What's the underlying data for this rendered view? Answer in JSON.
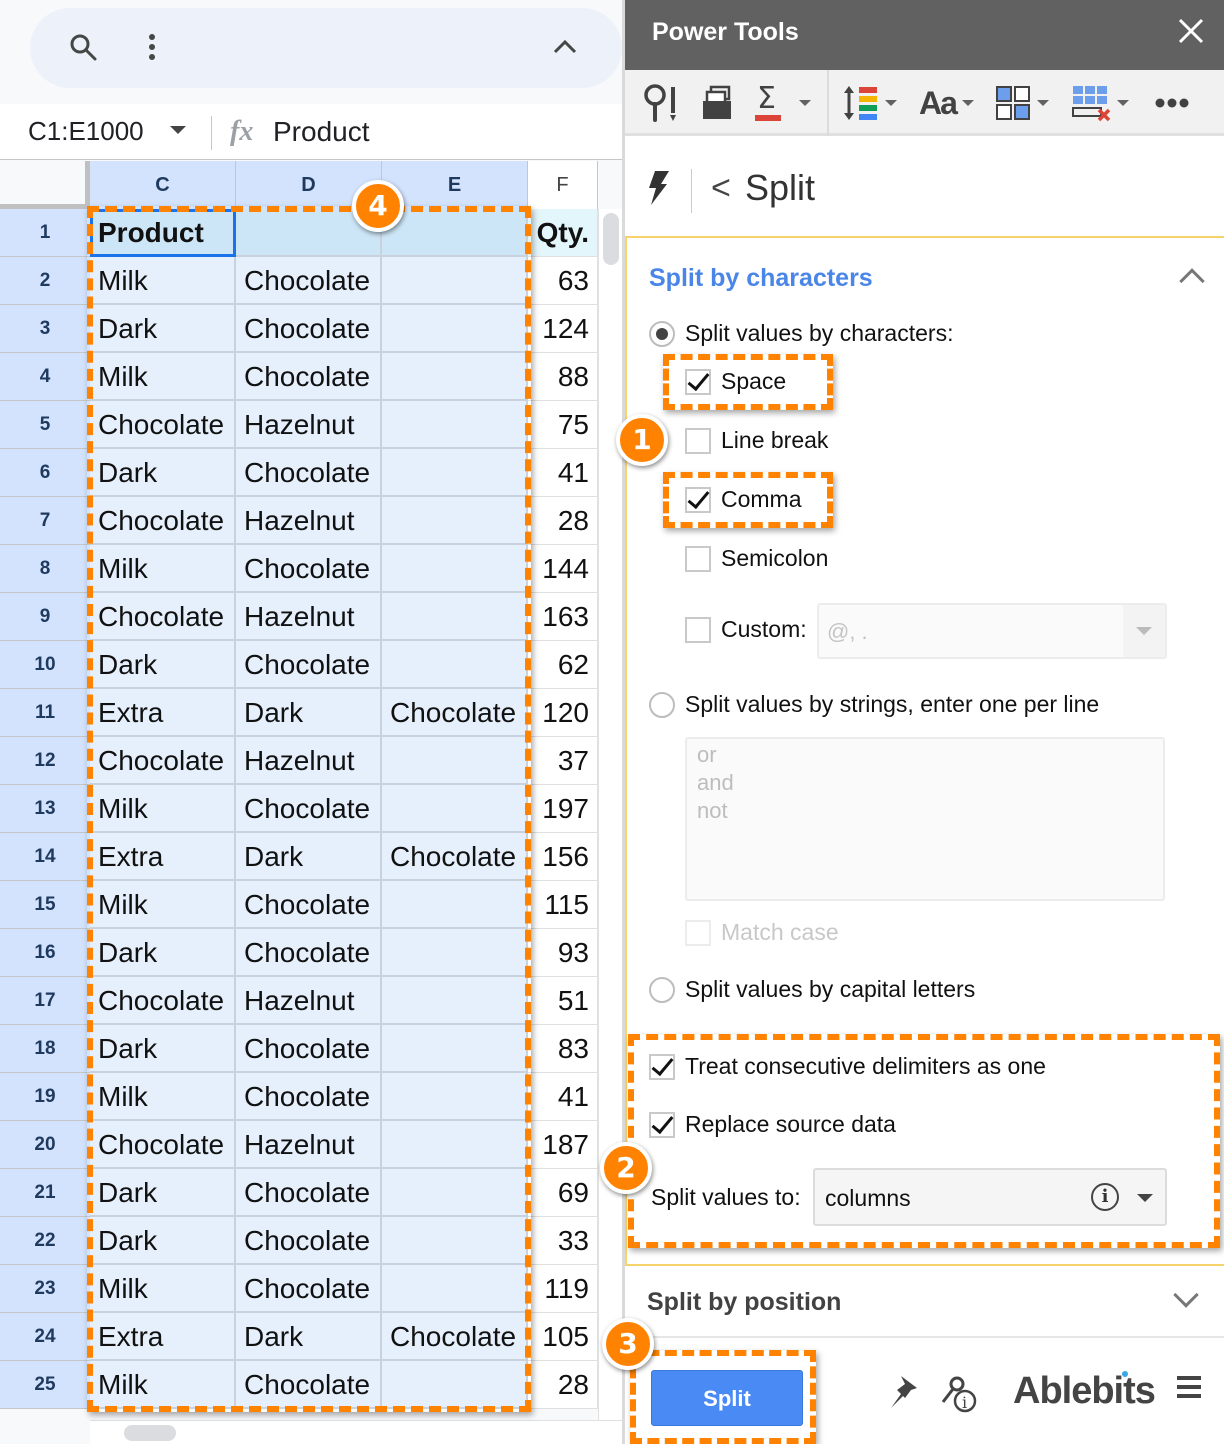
{
  "sheet": {
    "topbar": {
      "search_icon": "search-icon",
      "more_icon": "more-vert-icon",
      "collapse_icon": "chevron-up-icon"
    },
    "name_box": "C1:E1000",
    "formula_value": "Product",
    "fx_label": "fx",
    "columns": [
      "C",
      "D",
      "E",
      "F"
    ],
    "header": {
      "row": "1",
      "C": "Product",
      "D": "",
      "E": "",
      "F": "Qty."
    },
    "rows": [
      {
        "n": "2",
        "C": "Milk",
        "D": "Chocolate",
        "E": "",
        "F": "63"
      },
      {
        "n": "3",
        "C": "Dark",
        "D": "Chocolate",
        "E": "",
        "F": "124"
      },
      {
        "n": "4",
        "C": "Milk",
        "D": "Chocolate",
        "E": "",
        "F": "88"
      },
      {
        "n": "5",
        "C": "Chocolate",
        "D": "Hazelnut",
        "E": "",
        "F": "75"
      },
      {
        "n": "6",
        "C": "Dark",
        "D": "Chocolate",
        "E": "",
        "F": "41"
      },
      {
        "n": "7",
        "C": "Chocolate",
        "D": "Hazelnut",
        "E": "",
        "F": "28"
      },
      {
        "n": "8",
        "C": "Milk",
        "D": "Chocolate",
        "E": "",
        "F": "144"
      },
      {
        "n": "9",
        "C": "Chocolate",
        "D": "Hazelnut",
        "E": "",
        "F": "163"
      },
      {
        "n": "10",
        "C": "Dark",
        "D": "Chocolate",
        "E": "",
        "F": "62"
      },
      {
        "n": "11",
        "C": "Extra",
        "D": "Dark",
        "E": "Chocolate",
        "F": "120"
      },
      {
        "n": "12",
        "C": "Chocolate",
        "D": "Hazelnut",
        "E": "",
        "F": "37"
      },
      {
        "n": "13",
        "C": "Milk",
        "D": "Chocolate",
        "E": "",
        "F": "197"
      },
      {
        "n": "14",
        "C": "Extra",
        "D": "Dark",
        "E": "Chocolate",
        "F": "156"
      },
      {
        "n": "15",
        "C": "Milk",
        "D": "Chocolate",
        "E": "",
        "F": "115"
      },
      {
        "n": "16",
        "C": "Dark",
        "D": "Chocolate",
        "E": "",
        "F": "93"
      },
      {
        "n": "17",
        "C": "Chocolate",
        "D": "Hazelnut",
        "E": "",
        "F": "51"
      },
      {
        "n": "18",
        "C": "Dark",
        "D": "Chocolate",
        "E": "",
        "F": "83"
      },
      {
        "n": "19",
        "C": "Milk",
        "D": "Chocolate",
        "E": "",
        "F": "41"
      },
      {
        "n": "20",
        "C": "Chocolate",
        "D": "Hazelnut",
        "E": "",
        "F": "187"
      },
      {
        "n": "21",
        "C": "Dark",
        "D": "Chocolate",
        "E": "",
        "F": "69"
      },
      {
        "n": "22",
        "C": "Dark",
        "D": "Chocolate",
        "E": "",
        "F": "33"
      },
      {
        "n": "23",
        "C": "Milk",
        "D": "Chocolate",
        "E": "",
        "F": "119"
      },
      {
        "n": "24",
        "C": "Extra",
        "D": "Dark",
        "E": "Chocolate",
        "F": "105"
      },
      {
        "n": "25",
        "C": "Milk",
        "D": "Chocolate",
        "E": "",
        "F": "28"
      }
    ]
  },
  "panel": {
    "title": "Power Tools",
    "close_icon": "close-icon",
    "toolbar": [
      {
        "name": "find-replace-icon",
        "dropdown": false
      },
      {
        "name": "dedupe-icon",
        "dropdown": false
      },
      {
        "name": "formulas-sigma-icon",
        "dropdown": true
      },
      {
        "name": "sort-icon",
        "dropdown": true
      },
      {
        "name": "text-case-icon",
        "dropdown": true
      },
      {
        "name": "split-merge-icon",
        "dropdown": true
      },
      {
        "name": "clear-table-icon",
        "dropdown": true
      },
      {
        "name": "more-icon",
        "dropdown": false
      }
    ],
    "breadcrumb": {
      "back_glyph": "<",
      "title": "Split"
    },
    "section1": {
      "title": "Split by characters",
      "radio_chars": "Split values by characters:",
      "chk_space": "Space",
      "chk_linebreak": "Line break",
      "chk_comma": "Comma",
      "chk_semicolon": "Semicolon",
      "chk_custom": "Custom:",
      "custom_placeholder": "@, .",
      "radio_strings": "Split values by strings, enter one per line",
      "strings_placeholder": "or\nand\nnot",
      "chk_matchcase": "Match case",
      "radio_capitals": "Split values by capital letters",
      "chk_consecutive": "Treat consecutive delimiters as one",
      "chk_replace": "Replace source data",
      "split_to_label": "Split values to:",
      "split_to_value": "columns",
      "state": {
        "space": true,
        "linebreak": false,
        "comma": true,
        "semicolon": false,
        "custom": false,
        "matchcase": false,
        "consecutive": true,
        "replace": true,
        "mode": "characters"
      }
    },
    "section2": {
      "title": "Split by position"
    },
    "footer": {
      "split_button": "Split",
      "brand": "Ablebits"
    }
  },
  "annotations": {
    "b1": "1",
    "b2": "2",
    "b3": "3",
    "b4": "4",
    "accent_color": "#ff8200"
  },
  "colors": {
    "accent_blue": "#4a86e8",
    "button_blue": "#4a8af4",
    "title_bar": "#616161",
    "selection": "#e6effc"
  }
}
